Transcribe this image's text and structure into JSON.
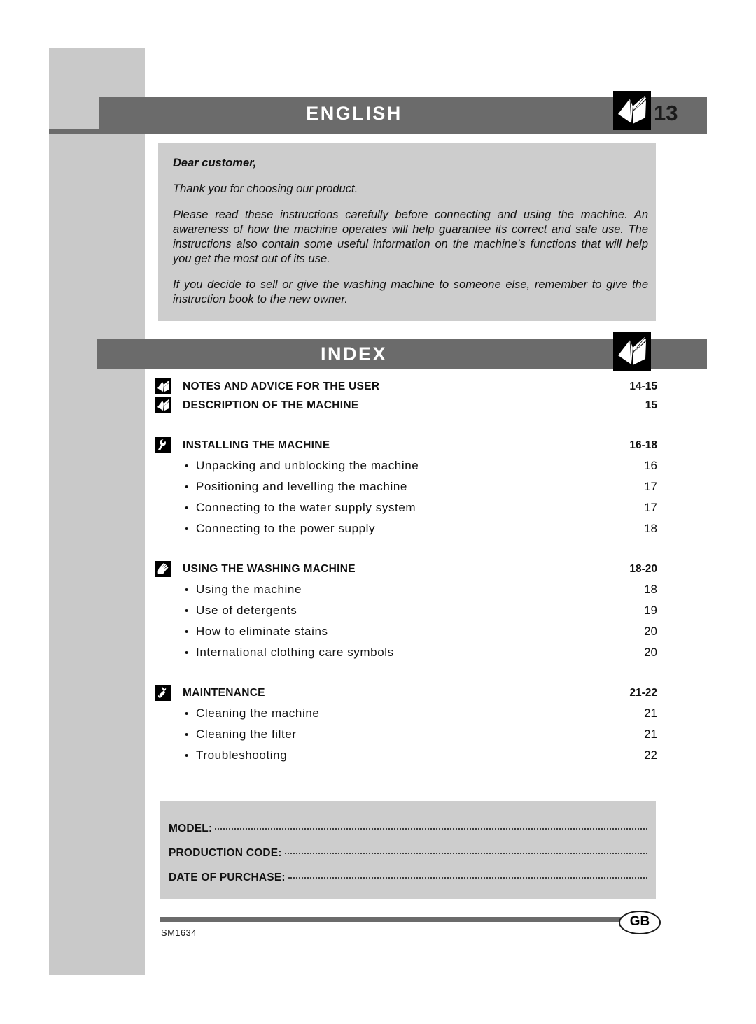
{
  "header": {
    "language_title": "ENGLISH",
    "page_number": "13",
    "book_icon": "open-book-icon"
  },
  "intro": {
    "salutation": "Dear customer,",
    "paragraphs": [
      "Thank you for choosing our product.",
      "Please read these instructions carefully before connecting and using the machine. An awareness of how the machine operates will help guarantee its correct and safe use. The instructions also contain some useful information on the machine’s functions that will help you get the most out of its use.",
      "If you decide to sell or give the washing machine to someone else, remember to give the instruction book to the new owner."
    ]
  },
  "index": {
    "title": "INDEX",
    "book_icon": "open-book-icon",
    "sections": [
      {
        "icon": "open-book-icon",
        "label": "NOTES AND ADVICE FOR THE USER",
        "pages": "14-15",
        "items": []
      },
      {
        "icon": "open-book-icon",
        "label": "DESCRIPTION OF THE MACHINE",
        "pages": "15",
        "items": []
      },
      {
        "icon": "wrench-icon",
        "label": "INSTALLING THE MACHINE",
        "pages": "16-18",
        "items": [
          {
            "bullet": "•",
            "label": "Unpacking and unblocking the machine",
            "page": "16"
          },
          {
            "bullet": "•",
            "label": "Positioning and levelling the machine",
            "page": "17"
          },
          {
            "bullet": "•",
            "label": "Connecting to the water supply system",
            "page": "17"
          },
          {
            "bullet": "•",
            "label": "Connecting to the power supply",
            "page": "18"
          }
        ]
      },
      {
        "icon": "hand-icon",
        "label": "USING THE WASHING MACHINE",
        "pages": "18-20",
        "items": [
          {
            "bullet": "•",
            "label": "Using the machine",
            "page": "18"
          },
          {
            "bullet": "•",
            "label": "Use of detergents",
            "page": "19"
          },
          {
            "bullet": "•",
            "label": "How to eliminate stains",
            "page": "20"
          },
          {
            "bullet": "•",
            "label": "International clothing care symbols",
            "page": "20"
          }
        ]
      },
      {
        "icon": "hand-with-brush-icon",
        "label": "MAINTENANCE",
        "pages": "21-22",
        "items": [
          {
            "bullet": "•",
            "label": "Cleaning the machine",
            "page": "21"
          },
          {
            "bullet": "•",
            "label": "Cleaning the filter",
            "page": "21"
          },
          {
            "bullet": "•",
            "label": "Troubleshooting",
            "page": "22"
          }
        ]
      }
    ]
  },
  "details": {
    "rows": [
      {
        "label": "MODEL:",
        "value": ""
      },
      {
        "label": "PRODUCTION CODE:",
        "value": ""
      },
      {
        "label": "DATE OF PURCHASE:",
        "value": ""
      }
    ]
  },
  "footer": {
    "document_code": "SM1634",
    "country_badge": "GB"
  },
  "colors": {
    "bar_grey": "#6b6b6b",
    "panel_grey": "#cdcdcd",
    "band_grey": "#c9c9c9",
    "ink": "#111111"
  }
}
